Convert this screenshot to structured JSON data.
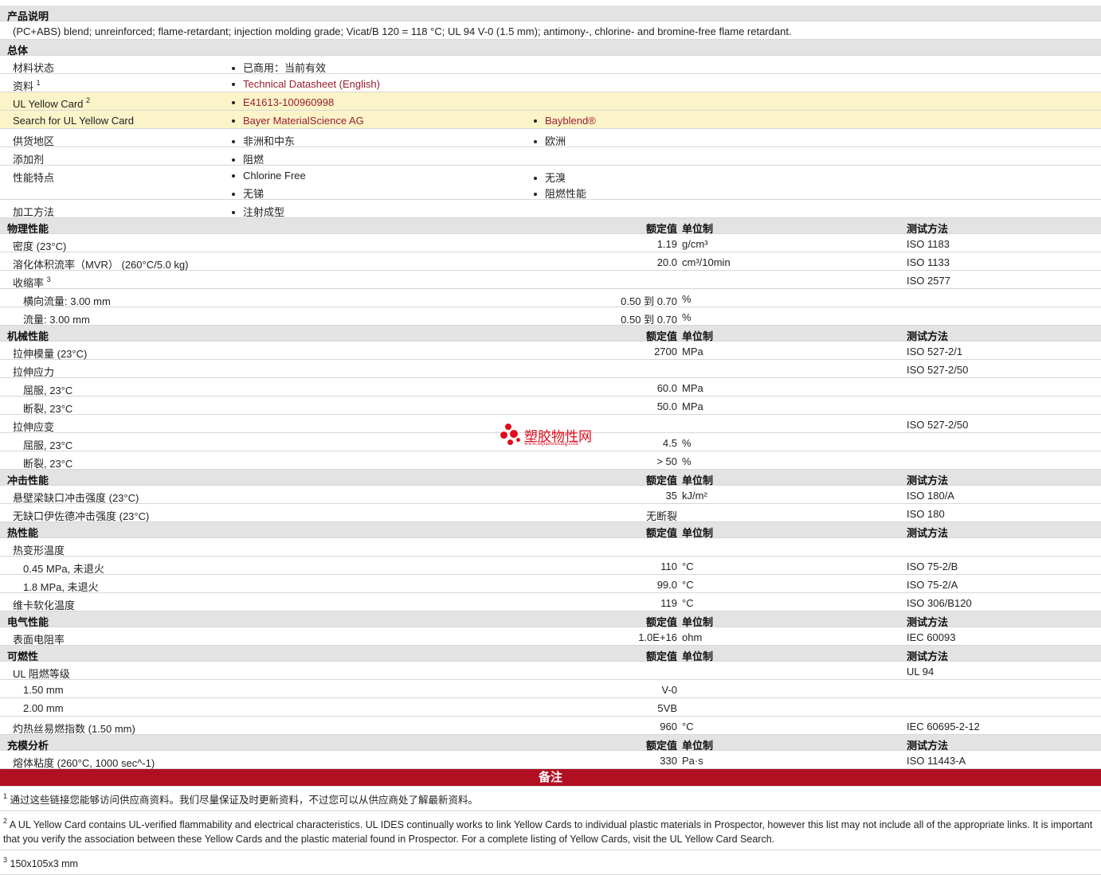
{
  "product_desc": {
    "header": "产品说明",
    "text": "(PC+ABS) blend; unreinforced; flame-retardant; injection molding grade; Vicat/B 120 = 118 °C; UL 94 V-0 (1.5 mm); antimony-, chlorine- and bromine-free flame retardant."
  },
  "general": {
    "header": "总体",
    "material_status": {
      "label": "材料状态",
      "value": "已商用：当前有效"
    },
    "documents": {
      "label": "资料",
      "sup": "1",
      "link": "Technical Datasheet (English)"
    },
    "ul_card": {
      "label": "UL Yellow Card",
      "sup": "2",
      "link": "E41613-100960998"
    },
    "ul_search": {
      "label": "Search for UL Yellow Card",
      "link1": "Bayer MaterialScience AG",
      "link2": "Bayblend®"
    },
    "region": {
      "label": "供货地区",
      "v1": "非洲和中东",
      "v2": "欧洲"
    },
    "additive": {
      "label": "添加剂",
      "v1": "阻燃"
    },
    "features": {
      "label": "性能特点",
      "v1": "Chlorine Free",
      "v2": "无溴",
      "v3": "无锑",
      "v4": "阻燃性能"
    },
    "processing": {
      "label": "加工方法",
      "v1": "注射成型"
    }
  },
  "col": {
    "nominal": "额定值",
    "unit": "单位制",
    "test": "测试方法"
  },
  "physical": {
    "header": "物理性能",
    "density": {
      "label": "密度 (23°C)",
      "value": "1.19",
      "unit": "g/cm³",
      "test": "ISO 1183"
    },
    "mvr": {
      "label": "溶化体积流率（MVR） (260°C/5.0 kg)",
      "value": "20.0",
      "unit": "cm³/10min",
      "test": "ISO 1133"
    },
    "shrink": {
      "label": "收缩率",
      "sup": "3",
      "test": "ISO 2577"
    },
    "shrink_trans": {
      "label": "横向流量: 3.00 mm",
      "value": "0.50 到  0.70",
      "unit": "%"
    },
    "shrink_flow": {
      "label": "流量: 3.00 mm",
      "value": "0.50 到  0.70",
      "unit": "%"
    }
  },
  "mechanical": {
    "header": "机械性能",
    "modulus": {
      "label": "拉伸模量 (23°C)",
      "value": "2700",
      "unit": "MPa",
      "test": "ISO 527-2/1"
    },
    "stress": {
      "label": "拉伸应力",
      "test": "ISO 527-2/50"
    },
    "stress_yield": {
      "label": "屈服, 23°C",
      "value": "60.0",
      "unit": "MPa"
    },
    "stress_break": {
      "label": "断裂, 23°C",
      "value": "50.0",
      "unit": "MPa"
    },
    "strain": {
      "label": "拉伸应变",
      "test": "ISO 527-2/50"
    },
    "strain_yield": {
      "label": "屈服, 23°C",
      "value": "4.5",
      "unit": "%"
    },
    "strain_break": {
      "label": "断裂, 23°C",
      "value": "> 50",
      "unit": "%"
    }
  },
  "impact": {
    "header": "冲击性能",
    "notched": {
      "label": "悬壁梁缺口冲击强度 (23°C)",
      "value": "35",
      "unit": "kJ/m²",
      "test": "ISO 180/A"
    },
    "unnotched": {
      "label": "无缺口伊佐德冲击强度 (23°C)",
      "value": "无断裂",
      "test": "ISO 180"
    }
  },
  "thermal": {
    "header": "热性能",
    "hdt": {
      "label": "热变形温度"
    },
    "hdt_045": {
      "label": "0.45 MPa, 未退火",
      "value": "110",
      "unit": "°C",
      "test": "ISO 75-2/B"
    },
    "hdt_18": {
      "label": "1.8 MPa, 未退火",
      "value": "99.0",
      "unit": "°C",
      "test": "ISO 75-2/A"
    },
    "vicat": {
      "label": "维卡软化温度",
      "value": "119",
      "unit": "°C",
      "test": "ISO 306/B120"
    }
  },
  "electrical": {
    "header": "电气性能",
    "surface_res": {
      "label": "表面电阻率",
      "value": "1.0E+16",
      "unit": "ohm",
      "test": "IEC 60093"
    }
  },
  "flammability": {
    "header": "可燃性",
    "ul": {
      "label": "UL 阻燃等级",
      "test": "UL 94"
    },
    "ul_150": {
      "label": "1.50 mm",
      "value": "V-0"
    },
    "ul_200": {
      "label": "2.00 mm",
      "value": "5VB"
    },
    "gwfi": {
      "label": "灼热丝易燃指数 (1.50 mm)",
      "value": "960",
      "unit": "°C",
      "test": "IEC 60695-2-12"
    }
  },
  "fill": {
    "header": "充模分析",
    "viscosity": {
      "label": "熔体粘度 (260°C, 1000 sec^-1)",
      "value": "330",
      "unit": "Pa·s",
      "test": "ISO 11443-A"
    }
  },
  "notes": {
    "header": "备注",
    "n1": {
      "sup": "1",
      "text": "通过这些链接您能够访问供应商资料。我们尽量保证及时更新资料，不过您可以从供应商处了解最新资料。"
    },
    "n2": {
      "sup": "2",
      "text": "A UL Yellow Card contains UL-verified flammability and electrical characteristics. UL IDES continually works to link Yellow Cards to individual plastic materials in Prospector, however this list may not include all of the appropriate links. It is important that you verify the association between these Yellow Cards and the plastic material found in Prospector. For a complete listing of Yellow Cards, visit the UL Yellow Card Search."
    },
    "n3": {
      "sup": "3",
      "text": "150x105x3 mm"
    }
  },
  "watermark": {
    "name": "塑胶物性网",
    "url": "www.sujiaowuxing.com",
    "color": "#e00b1c"
  },
  "colors": {
    "link": "#9b1c2e",
    "section_bg": "#e3e3e3",
    "highlight_bg": "#fbf4c9",
    "notes_bar": "#b10f22"
  }
}
